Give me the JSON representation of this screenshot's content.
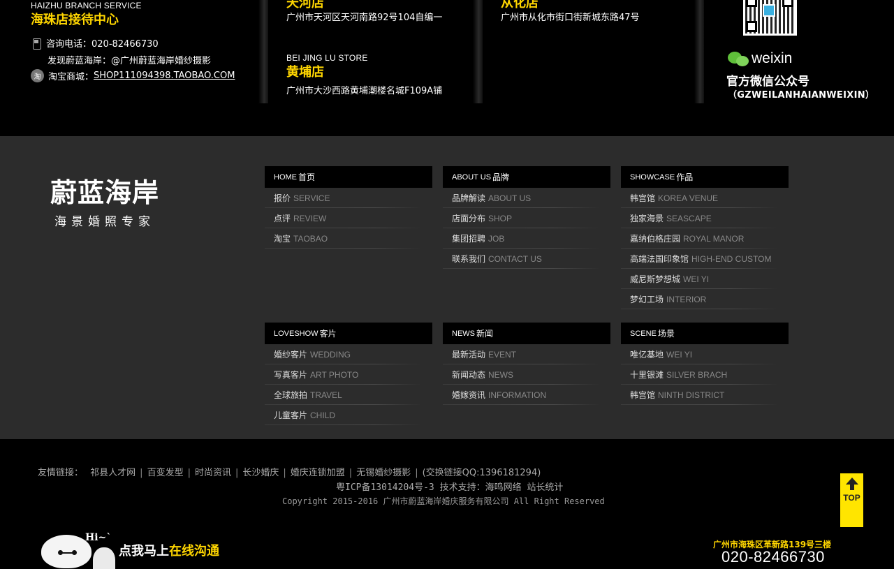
{
  "stores": {
    "haizhu": {
      "en": "HAIZHU BRANCH SERVICE",
      "cn": "海珠店接待中心"
    },
    "tianhe": {
      "cn": "天河店",
      "addr": "广州市天河区天河南路92号104自编一"
    },
    "conghua": {
      "cn": "从化店",
      "addr": "广州市从化市街口街新城东路47号"
    },
    "huangpu": {
      "en": "BEI JING LU STORE",
      "cn": "黄埔店",
      "addr": "广州市大沙西路黄埔潮楼名城F109A铺"
    }
  },
  "contact": {
    "phone_label": "咨询电话：020-82466730",
    "weibo_label": "发现蔚蓝海岸：@广州蔚蓝海岸婚纱摄影",
    "taobao_prefix": "淘宝商城：",
    "taobao_url": "SHOP111094398.TAOBAO.COM",
    "taobao_icon": "淘"
  },
  "wechat": {
    "logo_text": "weixin",
    "title": "官方微信公众号",
    "id": "（GZWEILANHAIANWEIXIN）"
  },
  "brand": {
    "name": "蔚蓝海岸",
    "tagline": "海景婚照专家"
  },
  "nav": {
    "home": {
      "en": "HOME",
      "cn": "首页",
      "items": [
        {
          "cn": "报价",
          "en": "SERVICE"
        },
        {
          "cn": "点评",
          "en": "REVIEW"
        },
        {
          "cn": "淘宝",
          "en": "TAOBAO"
        }
      ]
    },
    "about": {
      "en": "ABOUT US",
      "cn": "品牌",
      "items": [
        {
          "cn": "品牌解读",
          "en": "ABOUT US"
        },
        {
          "cn": "店面分布",
          "en": "SHOP"
        },
        {
          "cn": "集团招聘",
          "en": "JOB"
        },
        {
          "cn": "联系我们",
          "en": "CONTACT US"
        }
      ]
    },
    "showcase": {
      "en": "SHOWCASE",
      "cn": "作品",
      "items": [
        {
          "cn": "韩宫馆",
          "en": "KOREA VENUE"
        },
        {
          "cn": "独家海景",
          "en": "SEASCAPE"
        },
        {
          "cn": "嘉纳伯格庄园",
          "en": "ROYAL MANOR"
        },
        {
          "cn": "高端法国印象馆",
          "en": "HIGH-END CUSTOM"
        },
        {
          "cn": "威尼斯梦想城",
          "en": "WEI YI"
        },
        {
          "cn": "梦幻工场",
          "en": "INTERIOR"
        }
      ]
    },
    "loveshow": {
      "en": "LOVESHOW",
      "cn": "客片",
      "items": [
        {
          "cn": "婚纱客片",
          "en": "WEDDING"
        },
        {
          "cn": "写真客片",
          "en": "ART PHOTO"
        },
        {
          "cn": "全球旅拍",
          "en": "TRAVEL"
        },
        {
          "cn": "儿童客片",
          "en": "CHILD"
        }
      ]
    },
    "news": {
      "en": "NEWS",
      "cn": "新闻",
      "items": [
        {
          "cn": "最新活动",
          "en": "EVENT"
        },
        {
          "cn": "新闻动态",
          "en": "NEWS"
        },
        {
          "cn": "婚嫁资讯",
          "en": "INFORMATION"
        }
      ]
    },
    "scene": {
      "en": "SCENE",
      "cn": "场景",
      "items": [
        {
          "cn": "唯亿基地",
          "en": "WEI YI"
        },
        {
          "cn": "十里银滩",
          "en": "SILVER BRACH"
        },
        {
          "cn": "韩宫馆",
          "en": "NINTH DISTRICT"
        }
      ]
    }
  },
  "footer": {
    "links_label": "友情链接：",
    "links": [
      "祁县人才网",
      "百变发型",
      "时尚资讯",
      "长沙婚庆",
      "婚庆连锁加盟",
      "无锡婚纱摄影",
      "(交换链接QQ:1396181294)"
    ],
    "icp": "粤ICP备13014204号-3 技术支持：海鸣网络 站长统计",
    "copyright": "Copyright 2015-2016 广州市蔚蓝海岸婚庆服务有限公司 All Right Reserved"
  },
  "top_button": "TOP",
  "chat": {
    "hi": "Hi~`",
    "prefix": "点我马上",
    "highlight": "在线沟通"
  },
  "bottom_contact": {
    "address": "广州市海珠区革新路139号三楼",
    "phone": "020-82466730"
  }
}
